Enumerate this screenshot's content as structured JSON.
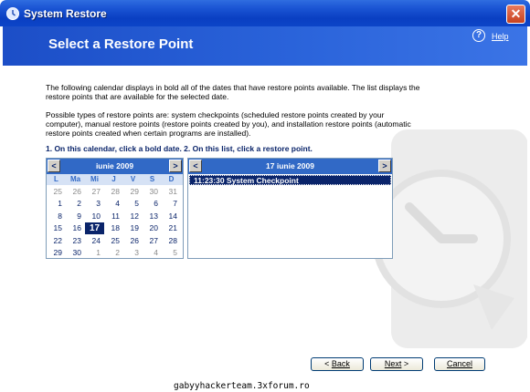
{
  "window": {
    "title": "System Restore"
  },
  "header": {
    "title": "Select a Restore Point",
    "help": "Help"
  },
  "intro": {
    "p1": "The following calendar displays in bold all of the dates that have restore points available. The list displays the restore points that are available for the selected date.",
    "p2": "Possible types of restore points are: system checkpoints (scheduled restore points created by your computer), manual restore points (restore points created by you), and installation restore points (automatic restore points created when certain programs are installed)."
  },
  "steps": {
    "text": "1. On this calendar, click a bold date.  2. On this list, click a restore point."
  },
  "calendar": {
    "month": "iunie 2009",
    "prev": "<",
    "next": ">",
    "weekdays": [
      "L",
      "Ma",
      "Mi",
      "J",
      "V",
      "S",
      "D"
    ],
    "weeks": [
      [
        "25",
        "26",
        "27",
        "28",
        "29",
        "30",
        "31"
      ],
      [
        "1",
        "2",
        "3",
        "4",
        "5",
        "6",
        "7"
      ],
      [
        "8",
        "9",
        "10",
        "11",
        "12",
        "13",
        "14"
      ],
      [
        "15",
        "16",
        "17",
        "18",
        "19",
        "20",
        "21"
      ],
      [
        "22",
        "23",
        "24",
        "25",
        "26",
        "27",
        "28"
      ],
      [
        "29",
        "30",
        "1",
        "2",
        "3",
        "4",
        "5"
      ]
    ],
    "selected": "17"
  },
  "restore_list": {
    "date": "17 iunie 2009",
    "prev": "<",
    "next": ">",
    "items": [
      "11:23:30  System Checkpoint"
    ]
  },
  "buttons": {
    "back": "Back",
    "next": "Next",
    "cancel": "Cancel"
  },
  "footer": {
    "watermark": "gabyyhackerteam.3xforum.ro"
  }
}
